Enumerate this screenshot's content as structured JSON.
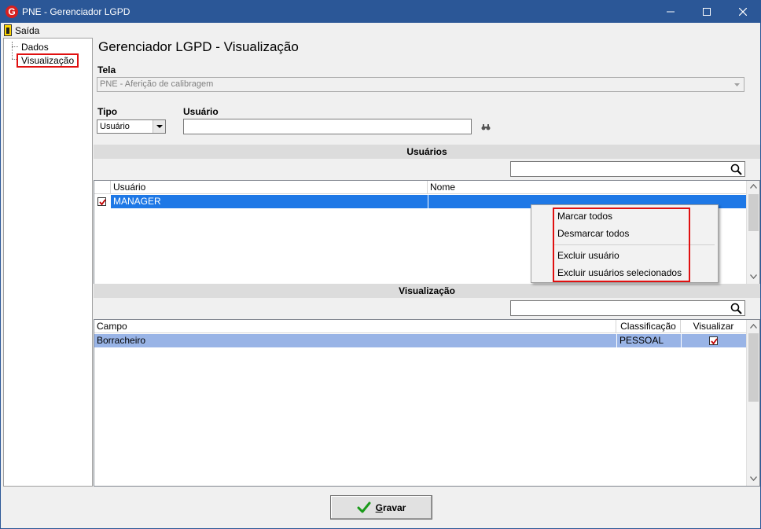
{
  "window": {
    "title": "PNE - Gerenciador LGPD",
    "app_icon_letter": "G",
    "accent_color": "#2b5797"
  },
  "menu": {
    "items": [
      {
        "label": "Saída",
        "icon": "exit-door-icon"
      }
    ]
  },
  "tree": {
    "items": [
      {
        "label": "Dados"
      },
      {
        "label": "Visualização",
        "selected": true
      }
    ]
  },
  "page": {
    "title": "Gerenciador LGPD - Visualização"
  },
  "tela": {
    "label": "Tela",
    "value": "PNE - Aferição de calibragem"
  },
  "tipo": {
    "label": "Tipo",
    "value": "Usuário"
  },
  "usuario_field": {
    "label": "Usuário",
    "value": "",
    "icon": "binoculars-icon"
  },
  "usuarios_section": {
    "title": "Usuários",
    "search_value": "",
    "columns": [
      "Usuário",
      "Nome"
    ],
    "rows": [
      {
        "checked": true,
        "usuario": "MANAGER",
        "nome": ""
      }
    ]
  },
  "context_menu": {
    "items": [
      "Marcar todos",
      "Desmarcar todos",
      "Excluir usuário",
      "Excluir usuários selecionados"
    ]
  },
  "visualizacao_section": {
    "title": "Visualização",
    "search_value": "",
    "columns": [
      "Campo",
      "Classificação",
      "Visualizar"
    ],
    "rows": [
      {
        "campo": "Borracheiro",
        "classificacao": "PESSOAL",
        "visualizar": true
      }
    ]
  },
  "footer": {
    "save_label": "Gravar",
    "save_mnemonic": "G",
    "save_rest": "ravar"
  },
  "colors": {
    "selection_blue": "#1e78e6",
    "row_light_blue": "#99b4e6",
    "highlight_red": "#e01010"
  }
}
